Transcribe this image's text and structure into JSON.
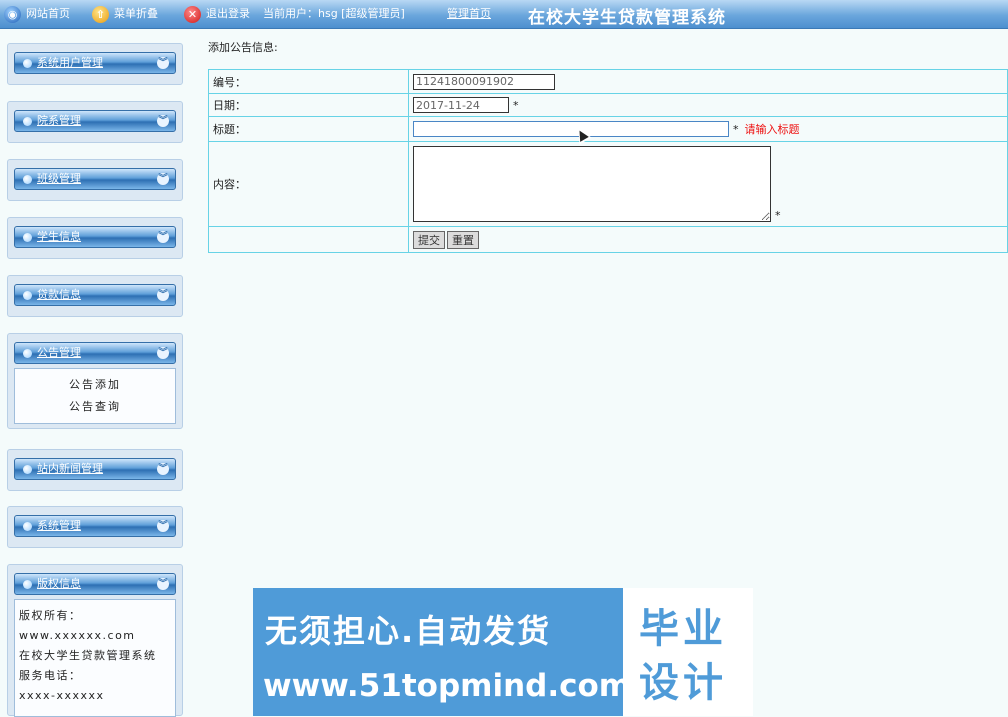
{
  "topbar": {
    "site_home": "网站首页",
    "menu_collapse": "菜单折叠",
    "logout": "退出登录",
    "current_user": "当前用户：hsg [超级管理员]",
    "admin_home": "管理首页",
    "system_title": "在校大学生贷款管理系统"
  },
  "sidebar": {
    "panels": [
      {
        "label": "系统用户管理"
      },
      {
        "label": "院系管理"
      },
      {
        "label": "班级管理"
      },
      {
        "label": "学生信息"
      },
      {
        "label": "贷款信息"
      },
      {
        "label": "公告管理",
        "items": [
          "公告添加",
          "公告查询"
        ]
      },
      {
        "label": "站内新闻管理"
      },
      {
        "label": "系统管理"
      },
      {
        "label": "版权信息",
        "lines": [
          "版权所有：",
          "www.xxxxxx.com",
          "在校大学生贷款管理系统",
          "服务电话：",
          "xxxx-xxxxxx"
        ]
      }
    ]
  },
  "form": {
    "title": "添加公告信息:",
    "number_label": "编号：",
    "number_value": "11241800091902",
    "date_label": "日期：",
    "date_value": "2017-11-24",
    "subject_label": "标题：",
    "subject_value": "",
    "subject_error": "请输入标题",
    "content_label": "内容：",
    "required_mark": "*",
    "submit_label": "提交",
    "reset_label": "重置"
  },
  "watermark": {
    "line1": "无须担心.自动发货",
    "line2": "www.51topmind.com",
    "box_line1": "毕业",
    "box_line2": "设计"
  }
}
